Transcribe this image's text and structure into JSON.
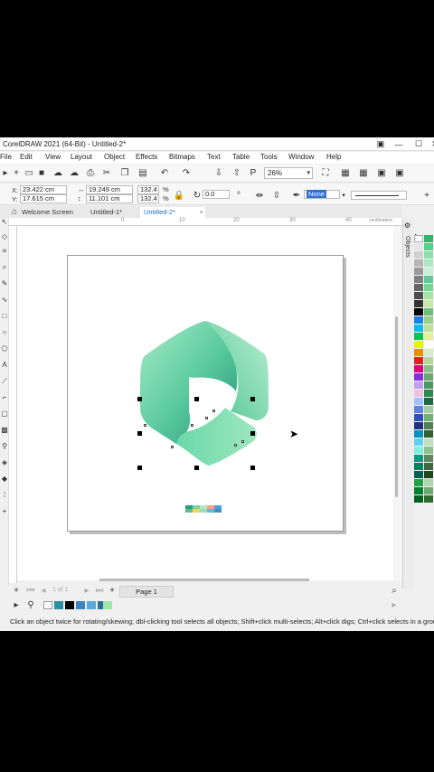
{
  "window": {
    "title": "CorelDRAW 2021 (64-Bit) - Untitled-2*",
    "controls": [
      "▣",
      "—",
      "☐",
      "✕"
    ]
  },
  "menu": [
    "File",
    "Edit",
    "View",
    "Layout",
    "Object",
    "Effects",
    "Bitmaps",
    "Text",
    "Table",
    "Tools",
    "Window",
    "Help"
  ],
  "toolbar": {
    "zoom": "26%"
  },
  "props": {
    "x_label": "X:",
    "x": "23.422 cm",
    "y_label": "Y:",
    "y": "17.615 cm",
    "w": "19.249 cm",
    "h": "11.101 cm",
    "sx": "132.4",
    "sy": "132.4",
    "pct1": "%",
    "pct2": "%",
    "angle": "0.0",
    "outline": "None"
  },
  "tabs": [
    {
      "label": "Welcome Screen"
    },
    {
      "label": "Untitled-1*"
    },
    {
      "label": "Untitled-2*"
    }
  ],
  "ruler": {
    "unit": "centimeters",
    "numbers": [
      "0",
      "10",
      "20",
      "30",
      "40"
    ]
  },
  "docker": {
    "label": "Objects"
  },
  "pagebar": {
    "page_label": "Page 1",
    "page_count": "1 of 1"
  },
  "status": "Click an object twice for rotating/skewing; dbl-clicking tool selects all objects; Shift+click multi-selects; Alt+click digs; Ctrl+click selects in a group",
  "colors": {
    "logo_light": "#8fe2b6",
    "logo_mid": "#5fcf9a",
    "logo_dark": "#2a9e83"
  }
}
